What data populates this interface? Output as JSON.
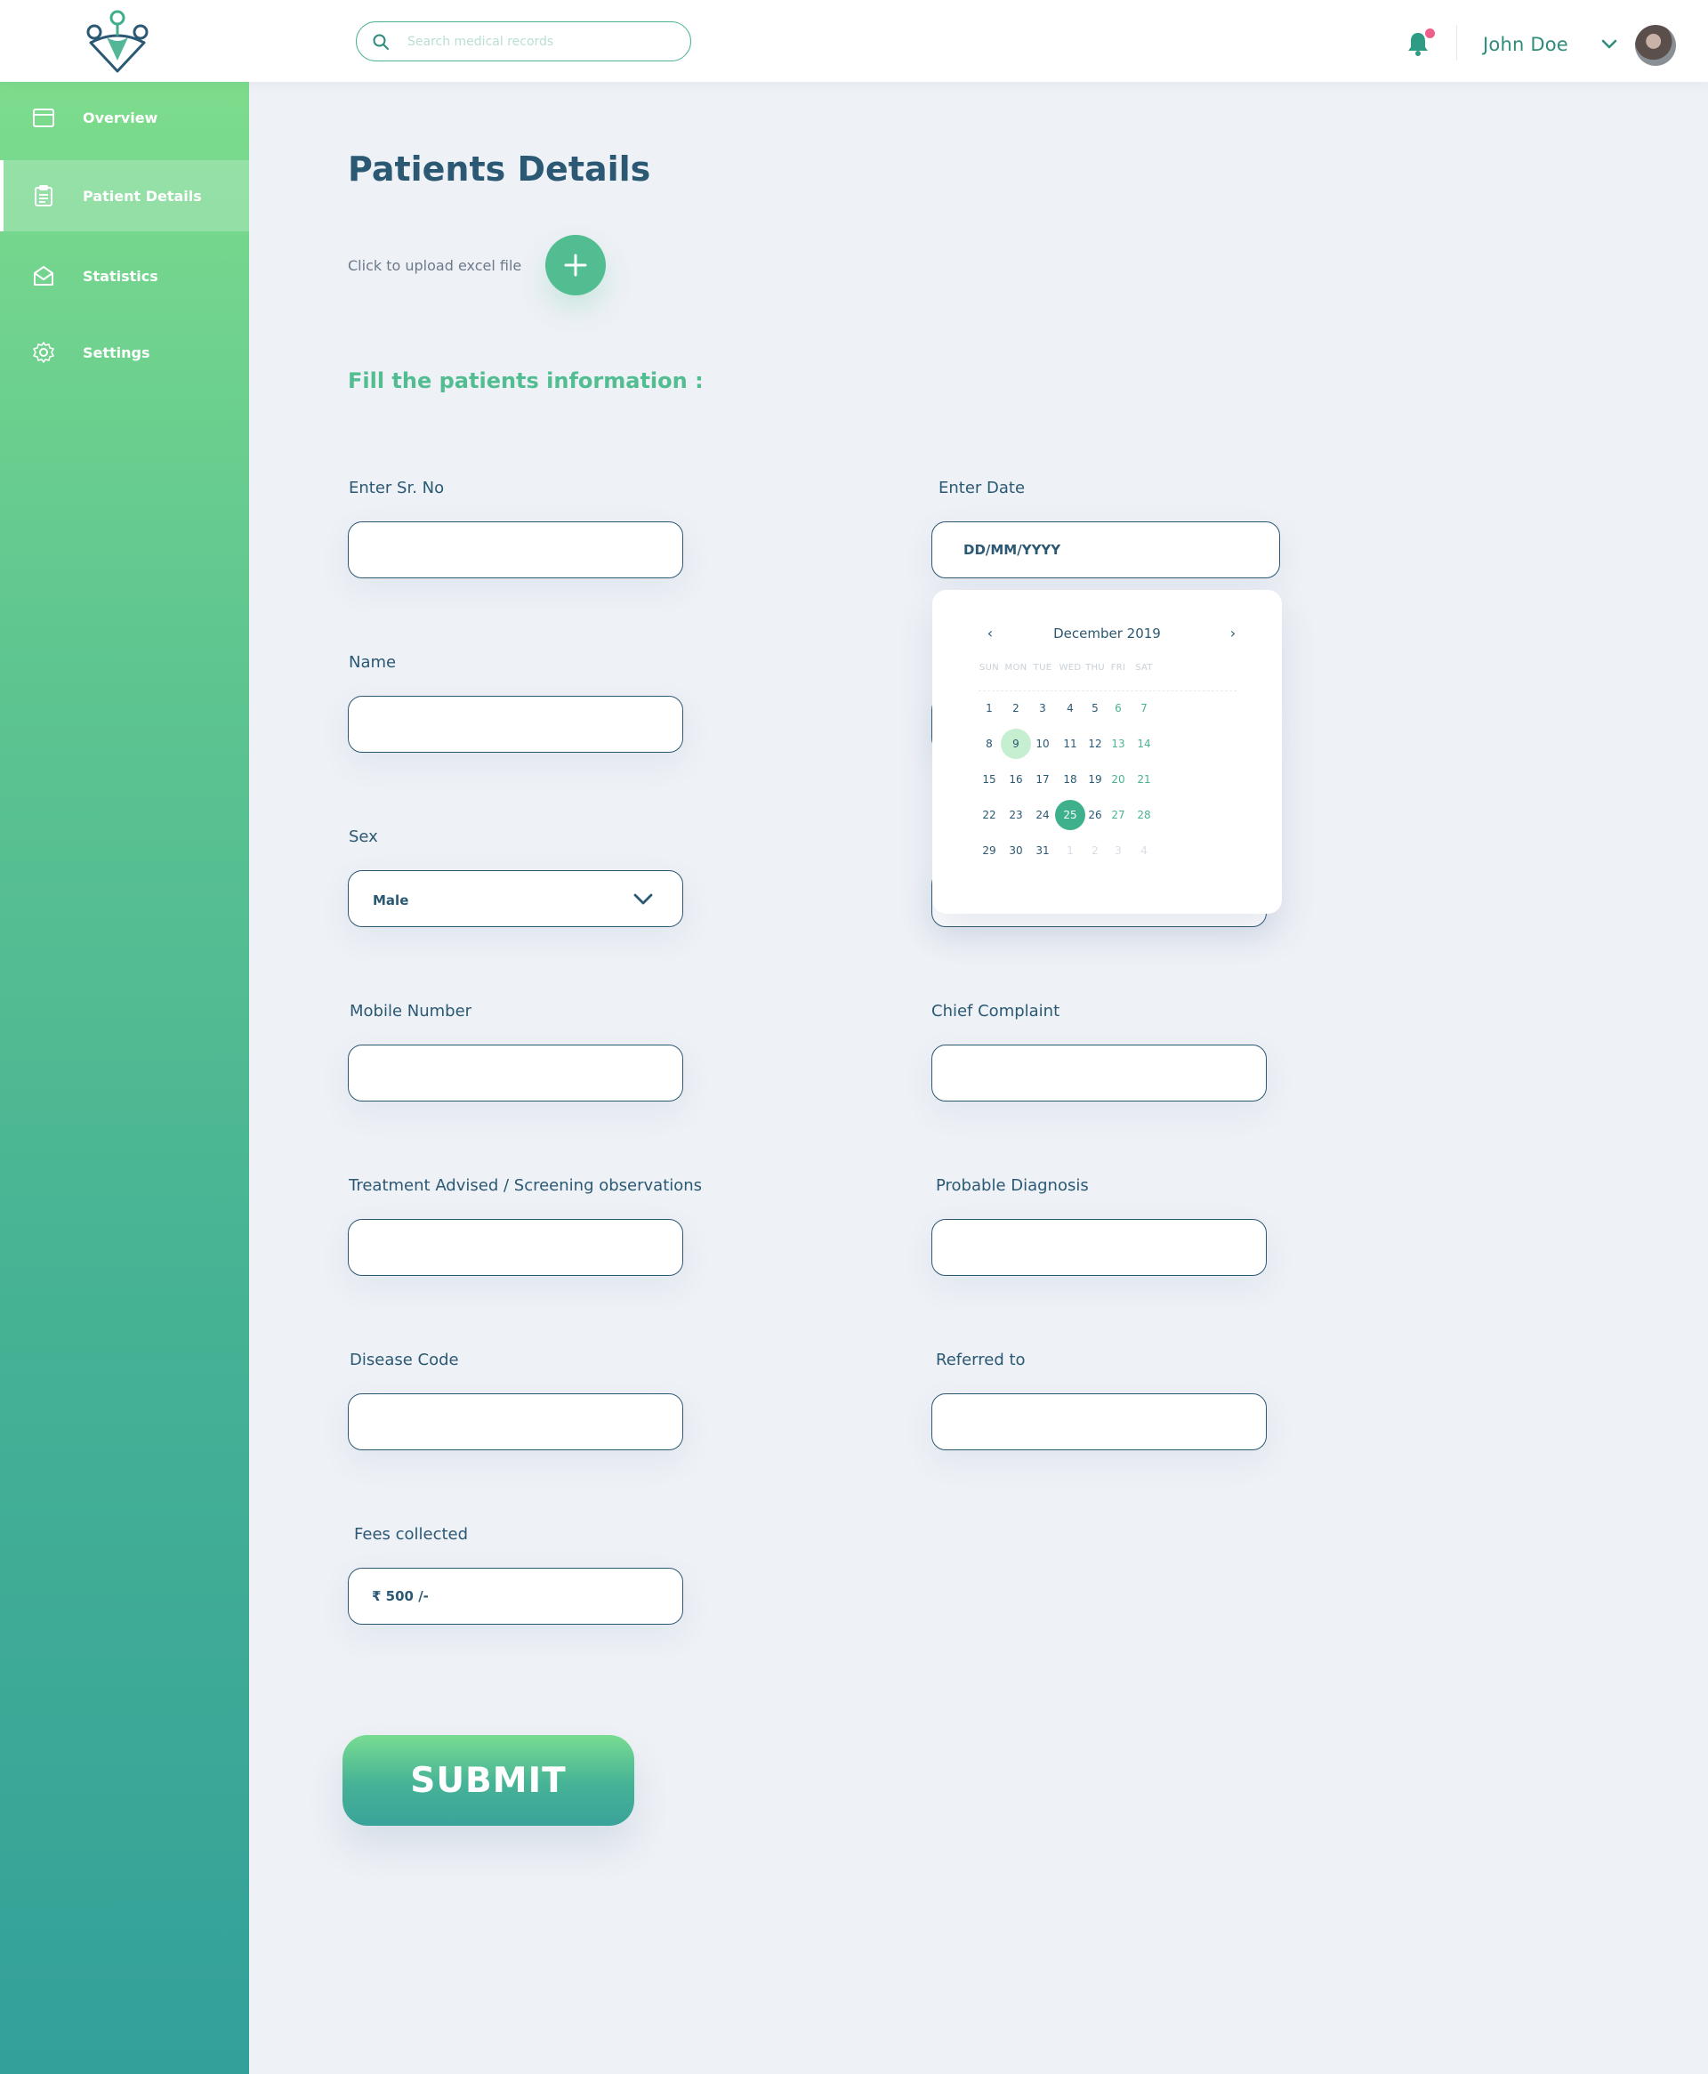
{
  "header": {
    "search_placeholder": "Search medical records",
    "user_name": "John Doe"
  },
  "sidebar": {
    "items": [
      {
        "label": "Overview",
        "icon": "calendar-icon"
      },
      {
        "label": "Patient Details",
        "icon": "clipboard-icon",
        "active": true
      },
      {
        "label": "Statistics",
        "icon": "envelope-icon"
      },
      {
        "label": "Settings",
        "icon": "gear-icon"
      }
    ]
  },
  "main": {
    "title": "Patients Details",
    "upload_text": "Click to upload excel file",
    "section_title": "Fill the patients information :",
    "fields": {
      "sr_no": {
        "label": "Enter Sr. No",
        "value": ""
      },
      "date": {
        "label": "Enter Date",
        "placeholder": "DD/MM/YYYY"
      },
      "name": {
        "label": "Name",
        "value": ""
      },
      "sex": {
        "label": "Sex",
        "value": "Male"
      },
      "mobile": {
        "label": "Mobile Number",
        "value": ""
      },
      "chief_complaint": {
        "label": "Chief Complaint",
        "value": ""
      },
      "treatment": {
        "label": "Treatment Advised / Screening observations",
        "value": ""
      },
      "diagnosis": {
        "label": "Probable Diagnosis",
        "value": ""
      },
      "disease_code": {
        "label": "Disease Code",
        "value": ""
      },
      "referred_to": {
        "label": "Referred to",
        "value": ""
      },
      "fees": {
        "label": "Fees collected",
        "value": "₹ 500 /-"
      }
    },
    "submit_label": "SUBMIT"
  },
  "calendar": {
    "month_label": "December 2019",
    "prev": "‹",
    "next": "›",
    "weekdays": [
      "SUN",
      "MON",
      "TUE",
      "WED",
      "THU",
      "FRI",
      "SAT"
    ],
    "weeks": [
      [
        "1",
        "2",
        "3",
        "4",
        "5",
        "6",
        "7"
      ],
      [
        "8",
        "9",
        "10",
        "11",
        "12",
        "13",
        "14"
      ],
      [
        "15",
        "16",
        "17",
        "18",
        "19",
        "20",
        "21"
      ],
      [
        "22",
        "23",
        "24",
        "25",
        "26",
        "27",
        "28"
      ],
      [
        "29",
        "30",
        "31",
        "1",
        "2",
        "3",
        "4"
      ]
    ],
    "today": "9",
    "selected": "25"
  },
  "colors": {
    "primary": "#2b5873",
    "accent": "#52bd90",
    "selected_day": "#3fb08c",
    "today_day": "#c6efd2",
    "notification_dot": "#ef5f8a"
  }
}
